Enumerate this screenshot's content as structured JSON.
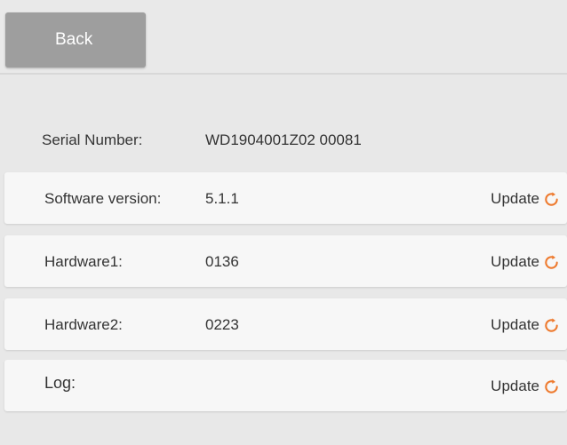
{
  "header": {
    "back_label": "Back"
  },
  "device": {
    "serial_label": "Serial Number:",
    "serial_value": "WD1904001Z02 00081"
  },
  "rows": [
    {
      "label": "Software version:",
      "value": "5.1.1",
      "action_label": "Update",
      "action_icon": "refresh-icon"
    },
    {
      "label": "Hardware1:",
      "value": "0136",
      "action_label": "Update",
      "action_icon": "refresh-icon"
    },
    {
      "label": "Hardware2:",
      "value": "0223",
      "action_label": "Update",
      "action_icon": "refresh-icon"
    },
    {
      "label": "Log:",
      "value": "",
      "action_label": "Update",
      "action_icon": "refresh-icon"
    }
  ],
  "colors": {
    "accent": "#ee7a2e",
    "background": "#e8e8e8",
    "card": "#f7f7f7",
    "button": "#9e9e9e"
  }
}
